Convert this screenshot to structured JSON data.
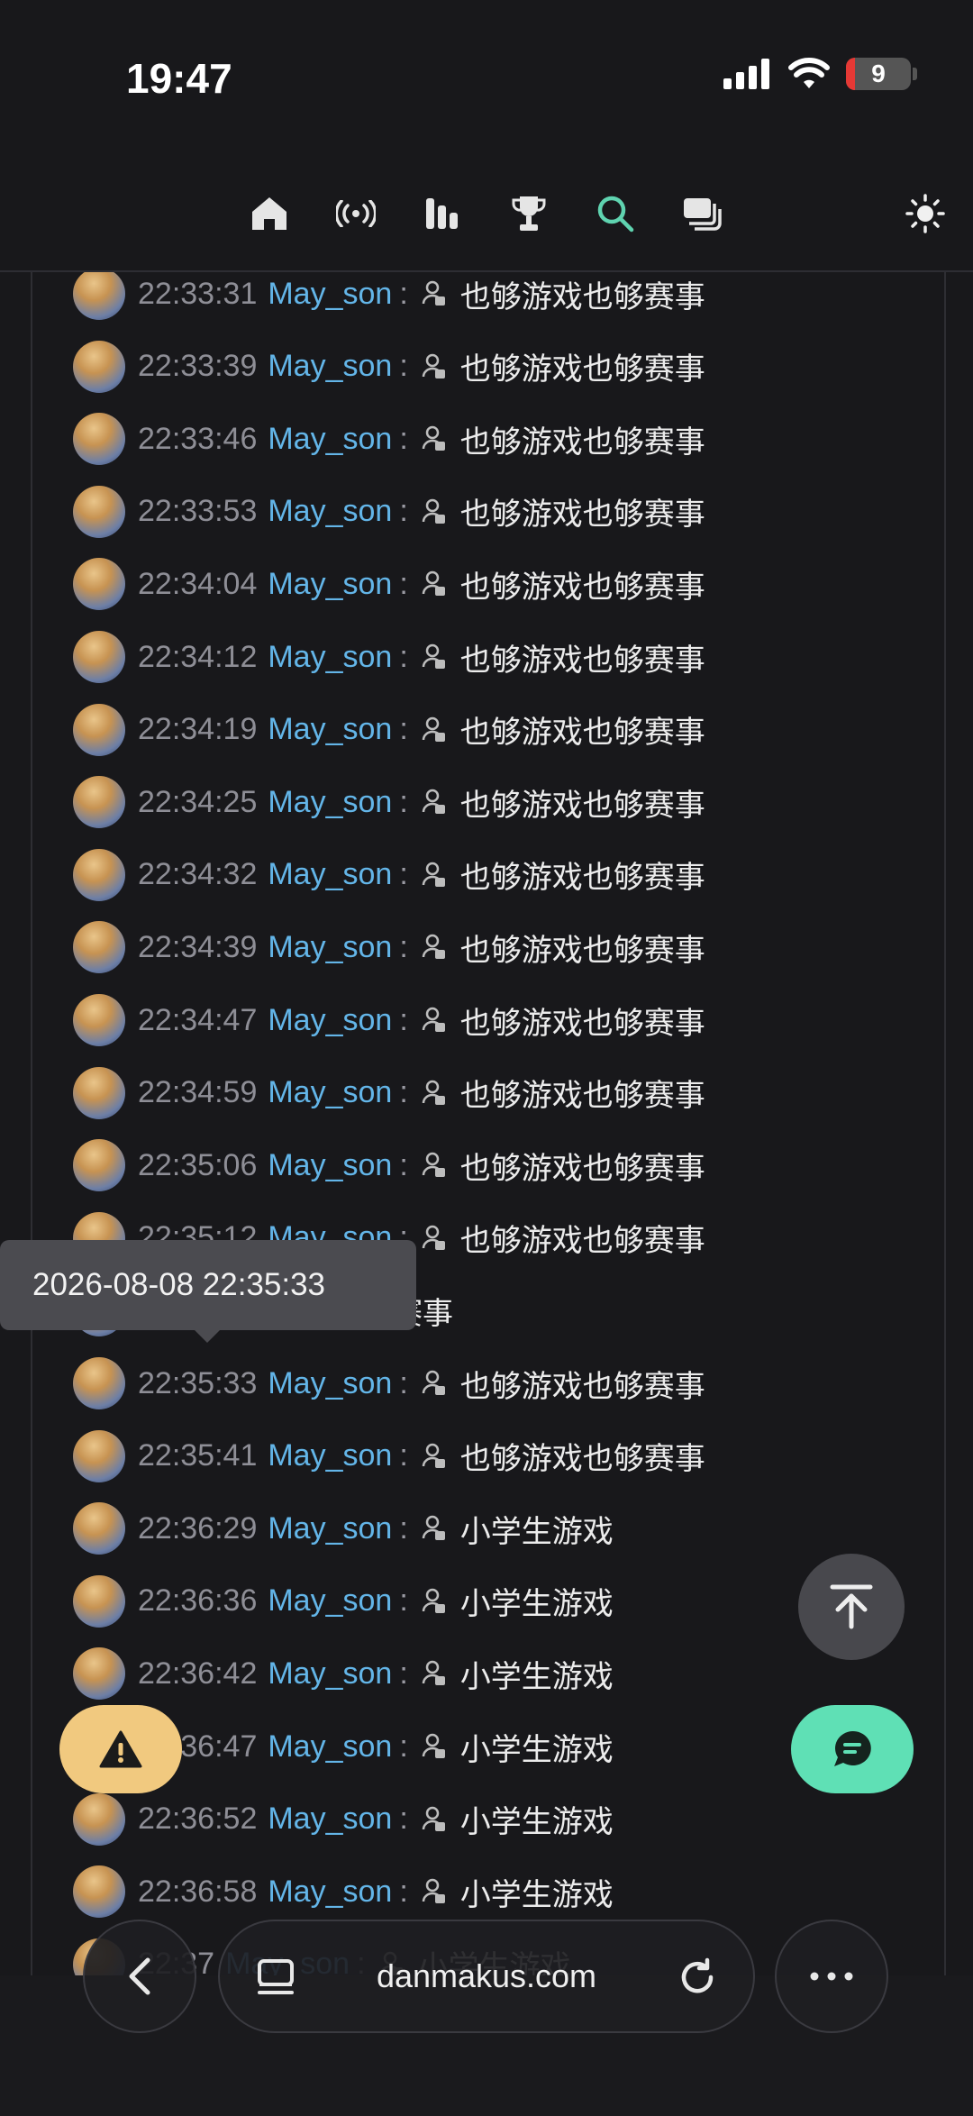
{
  "status_bar": {
    "time": "19:47",
    "battery": "9"
  },
  "nav": {
    "icons": [
      "home-icon",
      "live-broadcast-icon",
      "stats-icon",
      "trophy-icon",
      "search-icon",
      "stack-icon"
    ],
    "active": "search-icon",
    "theme_icon": "sun-icon",
    "accent_color": "#5fd3b0"
  },
  "messages": [
    {
      "time": "22:33:31",
      "user": "May_son",
      "sep": ":",
      "text": "也够游戏也够赛事"
    },
    {
      "time": "22:33:39",
      "user": "May_son",
      "sep": ":",
      "text": "也够游戏也够赛事"
    },
    {
      "time": "22:33:46",
      "user": "May_son",
      "sep": ":",
      "text": "也够游戏也够赛事"
    },
    {
      "time": "22:33:53",
      "user": "May_son",
      "sep": ":",
      "text": "也够游戏也够赛事"
    },
    {
      "time": "22:34:04",
      "user": "May_son",
      "sep": ":",
      "text": "也够游戏也够赛事"
    },
    {
      "time": "22:34:12",
      "user": "May_son",
      "sep": ":",
      "text": "也够游戏也够赛事"
    },
    {
      "time": "22:34:19",
      "user": "May_son",
      "sep": ":",
      "text": "也够游戏也够赛事"
    },
    {
      "time": "22:34:25",
      "user": "May_son",
      "sep": ":",
      "text": "也够游戏也够赛事"
    },
    {
      "time": "22:34:32",
      "user": "May_son",
      "sep": ":",
      "text": "也够游戏也够赛事"
    },
    {
      "time": "22:34:39",
      "user": "May_son",
      "sep": ":",
      "text": "也够游戏也够赛事"
    },
    {
      "time": "22:34:47",
      "user": "May_son",
      "sep": ":",
      "text": "也够游戏也够赛事"
    },
    {
      "time": "22:34:59",
      "user": "May_son",
      "sep": ":",
      "text": "也够游戏也够赛事"
    },
    {
      "time": "22:35:06",
      "user": "May_son",
      "sep": ":",
      "text": "也够游戏也够赛事"
    },
    {
      "time": "22:35:12",
      "user": "May_son",
      "sep": ":",
      "text": "也够游戏也够赛事"
    },
    {
      "time": "",
      "user": "",
      "sep": "",
      "text": "也够游戏也够赛事"
    },
    {
      "time": "22:35:33",
      "user": "May_son",
      "sep": ":",
      "text": "也够游戏也够赛事"
    },
    {
      "time": "22:35:41",
      "user": "May_son",
      "sep": ":",
      "text": "也够游戏也够赛事"
    },
    {
      "time": "22:36:29",
      "user": "May_son",
      "sep": ":",
      "text": "小学生游戏"
    },
    {
      "time": "22:36:36",
      "user": "May_son",
      "sep": ":",
      "text": "小学生游戏"
    },
    {
      "time": "22:36:42",
      "user": "May_son",
      "sep": ":",
      "text": "小学生游戏"
    },
    {
      "time": "22:36:47",
      "user": "May_son",
      "sep": ":",
      "text": "小学生游戏"
    },
    {
      "time": "22:36:52",
      "user": "May_son",
      "sep": ":",
      "text": "小学生游戏"
    },
    {
      "time": "22:36:58",
      "user": "May_son",
      "sep": ":",
      "text": "小学生游戏"
    },
    {
      "time": "22:37",
      "user": "May_son",
      "sep": ":",
      "text": "小学生游戏"
    }
  ],
  "tooltip": {
    "text": "2026-08-08 22:35:33"
  },
  "floating": {
    "scroll_top_icon": "arrow-up-to-top-icon",
    "report_icon": "warning-icon",
    "chat_icon": "chat-bubble-icon"
  },
  "browser": {
    "url": "danmakus.com",
    "back_icon": "chevron-left-icon",
    "tabs_icon": "page-menu-icon",
    "reload_icon": "reload-icon",
    "more_icon": "more-icon"
  }
}
